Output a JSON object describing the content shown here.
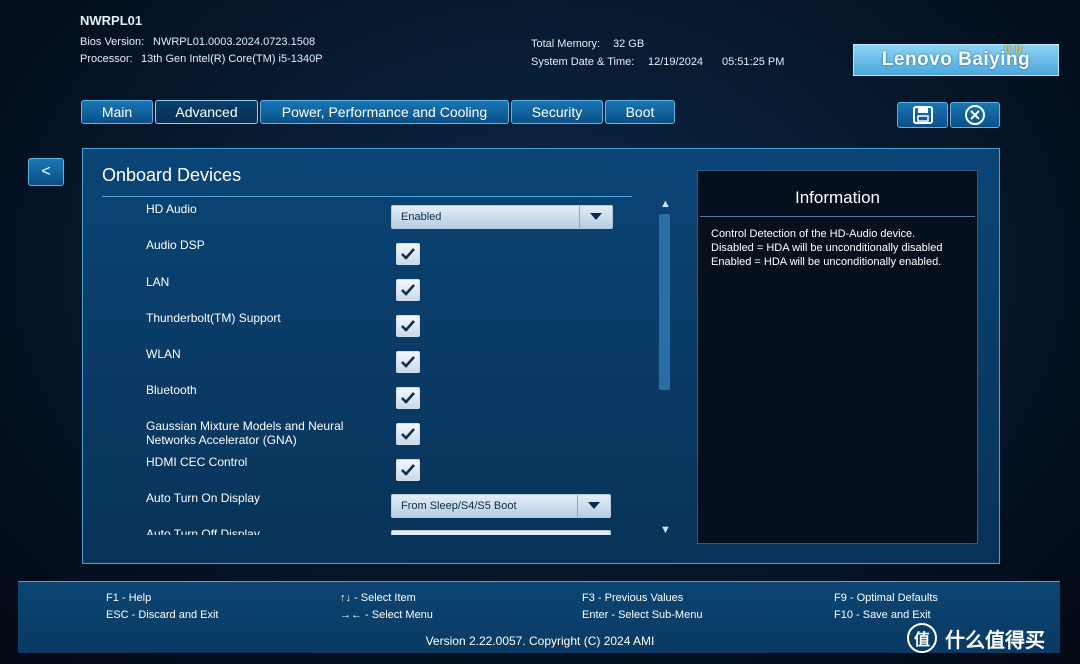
{
  "header": {
    "model": "NWRPL01",
    "bios_label": "Bios Version:",
    "bios_value": "NWRPL01.0003.2024.0723.1508",
    "processor_label": "Processor:",
    "processor_value": "13th Gen Intel(R) Core(TM) i5-1340P",
    "memory_label": "Total Memory:",
    "memory_value": "32 GB",
    "datetime_label": "System Date & Time:",
    "date_value": "12/19/2024",
    "time_value": "05:51:25 PM",
    "brand": "Lenovo Baiying"
  },
  "tabs": [
    {
      "label": "Main"
    },
    {
      "label": "Advanced"
    },
    {
      "label": "Power, Performance and Cooling"
    },
    {
      "label": "Security"
    },
    {
      "label": "Boot"
    }
  ],
  "active_tab": "Advanced",
  "back_label": "<",
  "section": {
    "title": "Onboard Devices",
    "items": [
      {
        "label": "HD Audio",
        "type": "dropdown",
        "value": "Enabled"
      },
      {
        "label": "Audio DSP",
        "type": "checkbox",
        "checked": true
      },
      {
        "label": "LAN",
        "type": "checkbox",
        "checked": true
      },
      {
        "label": "Thunderbolt(TM) Support",
        "type": "checkbox",
        "checked": true
      },
      {
        "label": "WLAN",
        "type": "checkbox",
        "checked": true
      },
      {
        "label": "Bluetooth",
        "type": "checkbox",
        "checked": true
      },
      {
        "label": "Gaussian Mixture Models and Neural",
        "label2": "Networks Accelerator (GNA)",
        "type": "checkbox",
        "checked": true
      },
      {
        "label": "HDMI CEC Control",
        "type": "checkbox",
        "checked": true
      },
      {
        "label": "Auto Turn On Display",
        "type": "dropdown",
        "value": "From Sleep/S4/S5 Boot"
      },
      {
        "label": "Auto Turn Off Display",
        "type": "dropdown",
        "value": ""
      }
    ]
  },
  "info": {
    "title": "Information",
    "text": "Control Detection of the HD-Audio device.\nDisabled = HDA will be unconditionally disabled\nEnabled = HDA will be unconditionally enabled."
  },
  "footer": {
    "keys": [
      "F1 - Help",
      "ESC - Discard and Exit",
      "↑↓ - Select Item",
      "→← - Select Menu",
      "F3 - Previous Values",
      "Enter - Select Sub-Menu",
      "F9 - Optimal Defaults",
      "F10 - Save and Exit"
    ],
    "copyright": "Version 2.22.0057. Copyright (C) 2024 AMI"
  },
  "watermark": {
    "logo": "值",
    "text": "什么值得买"
  },
  "colors": {
    "accent": "#1a76b4",
    "panel": "#0a4576",
    "info_bg": "#06101c"
  }
}
